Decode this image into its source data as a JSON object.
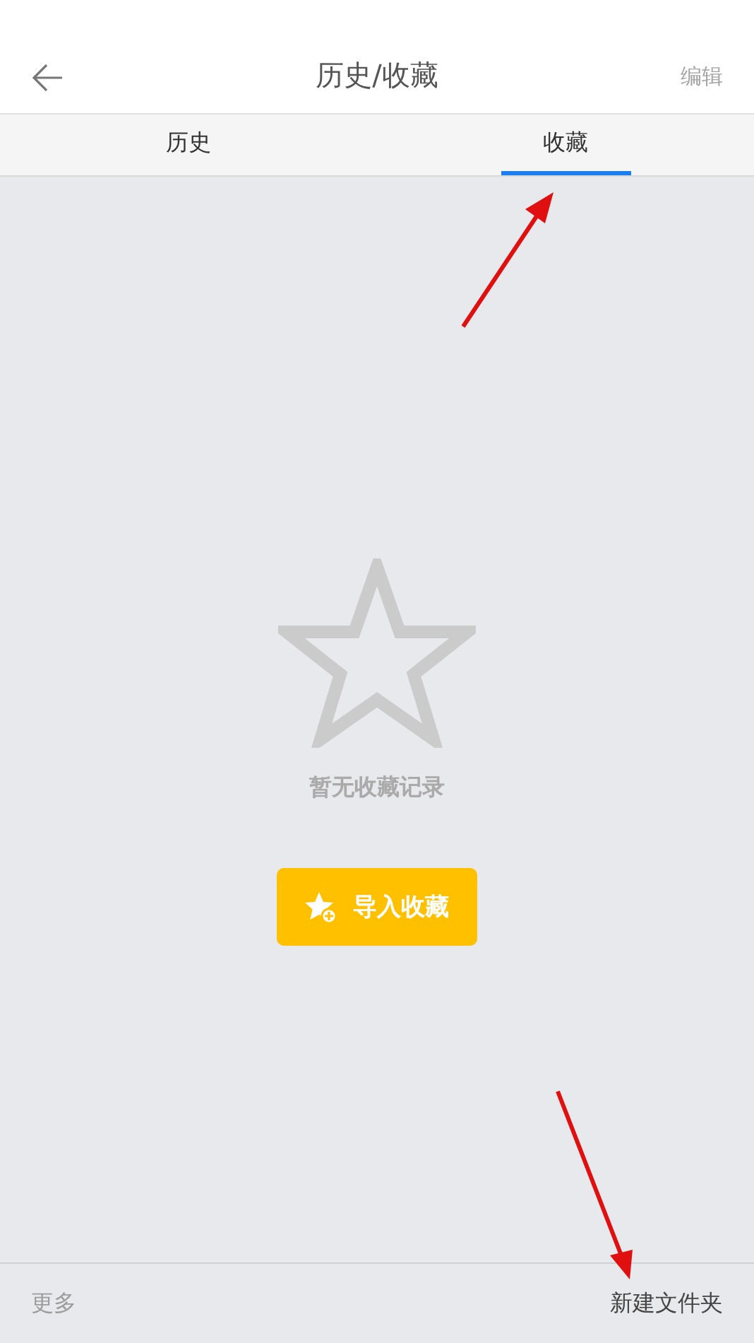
{
  "header": {
    "title": "历史/收藏",
    "edit": {
      "label": "编辑",
      "disabled": true
    }
  },
  "tabs": [
    {
      "label": "历史",
      "selected": false
    },
    {
      "label": "收藏",
      "selected": true
    }
  ],
  "empty_state": {
    "message": "暂无收藏记录",
    "button": "导入收藏"
  },
  "bottom_bar": [
    {
      "label": "更多",
      "disabled": true
    },
    {
      "label": "新建文件夹",
      "disabled": false
    }
  ]
}
